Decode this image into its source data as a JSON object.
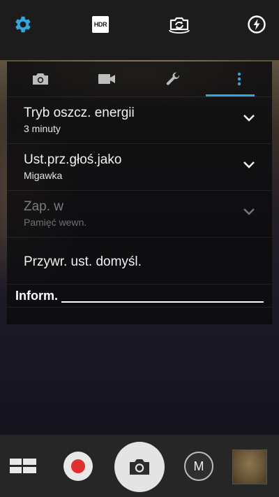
{
  "top_bar": {
    "icons": [
      "gear-icon",
      "hdr-icon",
      "switch-camera-icon",
      "flash-auto-icon"
    ],
    "hdr_label": "HDR",
    "accent": "#33a6e0"
  },
  "settings": {
    "tabs": [
      {
        "icon": "camera-icon",
        "active": false
      },
      {
        "icon": "video-icon",
        "active": false
      },
      {
        "icon": "wrench-icon",
        "active": false
      },
      {
        "icon": "more-vert-icon",
        "active": true
      }
    ],
    "rows": [
      {
        "title": "Tryb oszcz. energii",
        "subtitle": "3 minuty",
        "enabled": true
      },
      {
        "title": "Ust.prz.głoś.jako",
        "subtitle": "Migawka",
        "enabled": true
      },
      {
        "title": "Zap. w",
        "subtitle": "Pamięć wewn.",
        "enabled": false
      }
    ],
    "reset_label": "Przywr. ust. domyśl.",
    "info_label": "Inform."
  },
  "bottom_bar": {
    "mode_label": "M",
    "icons": [
      "grid-menu-icon",
      "record-icon",
      "shutter-icon",
      "mode-icon",
      "gallery-thumbnail"
    ]
  }
}
